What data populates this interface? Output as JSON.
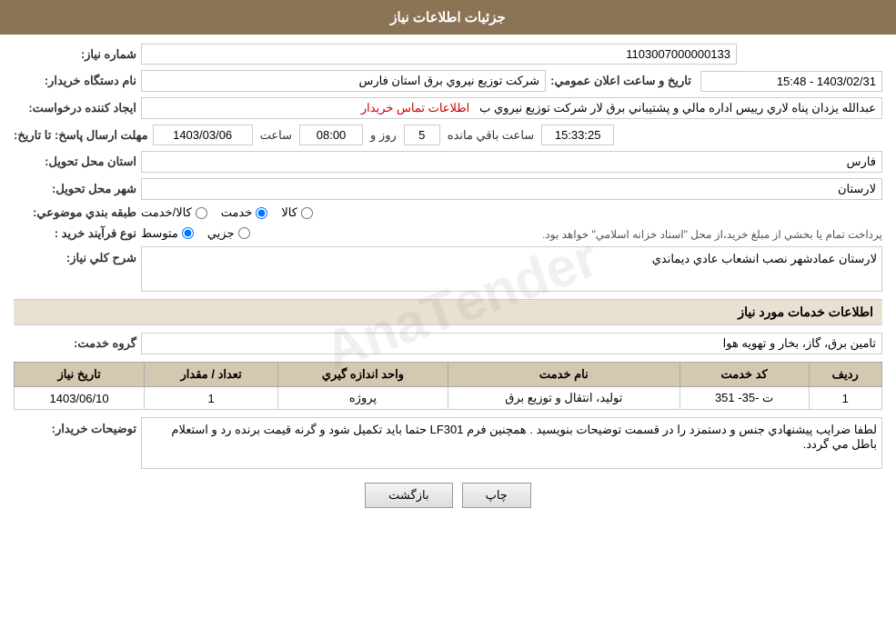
{
  "header": {
    "title": "جزئيات اطلاعات نياز"
  },
  "fields": {
    "number_label": "شماره نياز:",
    "number_value": "1103007000000133",
    "buyer_org_label": "نام دستگاه خريدار:",
    "buyer_org_value": "شركت توزيع نيروي برق استان فارس",
    "creator_label": "ايجاد كننده درخواست:",
    "creator_value": "عبدالله يزدان پناه لاري رييس اداره مالي و پشتيباني برق لار شركت توزيع نيروي ب",
    "creator_link": "اطلاعات تماس خريدار",
    "deadline_label": "مهلت ارسال پاسخ: تا تاريخ:",
    "deadline_date": "1403/03/06",
    "deadline_time_label": "ساعت",
    "deadline_time": "08:00",
    "deadline_day_label": "روز و",
    "deadline_days": "5",
    "deadline_remaining_label": "ساعت باقي مانده",
    "deadline_remaining": "15:33:25",
    "announce_label": "تاريخ و ساعت اعلان عمومي:",
    "announce_value": "1403/02/31 - 15:48",
    "province_label": "استان محل تحويل:",
    "province_value": "فارس",
    "city_label": "شهر محل تحويل:",
    "city_value": "لارستان",
    "category_label": "طبقه بندي موضوعي:",
    "category_options": [
      {
        "id": "kala",
        "label": "كالا"
      },
      {
        "id": "khedmat",
        "label": "خدمت"
      },
      {
        "id": "kala_khedmat",
        "label": "كالا/خدمت"
      }
    ],
    "category_selected": "khedmat",
    "purchase_type_label": "نوع فرآيند خريد :",
    "purchase_options": [
      {
        "id": "jozii",
        "label": "جزيي"
      },
      {
        "id": "motavasset",
        "label": "متوسط"
      }
    ],
    "purchase_note": "پرداخت تمام يا بخشي از مبلغ خريد،از محل \"اسناد خزانه اسلامي\" خواهد بود.",
    "purchase_selected": "motavasset"
  },
  "description_section": {
    "label": "شرح كلي نياز:",
    "value": "لارستان عمادشهر نصب انشعاب عادي ديماندي"
  },
  "services_section": {
    "title": "اطلاعات خدمات مورد نياز",
    "service_group_label": "گروه خدمت:",
    "service_group_value": "تامين برق، گاز، بخار و تهويه هوا",
    "table": {
      "headers": [
        "رديف",
        "كد خدمت",
        "نام خدمت",
        "واحد اندازه گيري",
        "تعداد / مقدار",
        "تاريخ نياز"
      ],
      "rows": [
        {
          "row_num": "1",
          "code": "ت -35- 351",
          "name": "توليد، انتقال و توزيع برق",
          "unit": "پروژه",
          "quantity": "1",
          "date": "1403/06/10"
        }
      ]
    }
  },
  "buyer_notes_section": {
    "label": "توضيحات خريدار:",
    "value": "لطفا ضرايب پيشنهادي جنس و دستمزد را در قسمت توضيحات بنويسيد . همچنين فرم LF301 حتما بايد تكميل شود و گرنه قيمت برنده رد و استعلام باطل مي گردد."
  },
  "buttons": {
    "back_label": "بازگشت",
    "print_label": "چاپ"
  }
}
